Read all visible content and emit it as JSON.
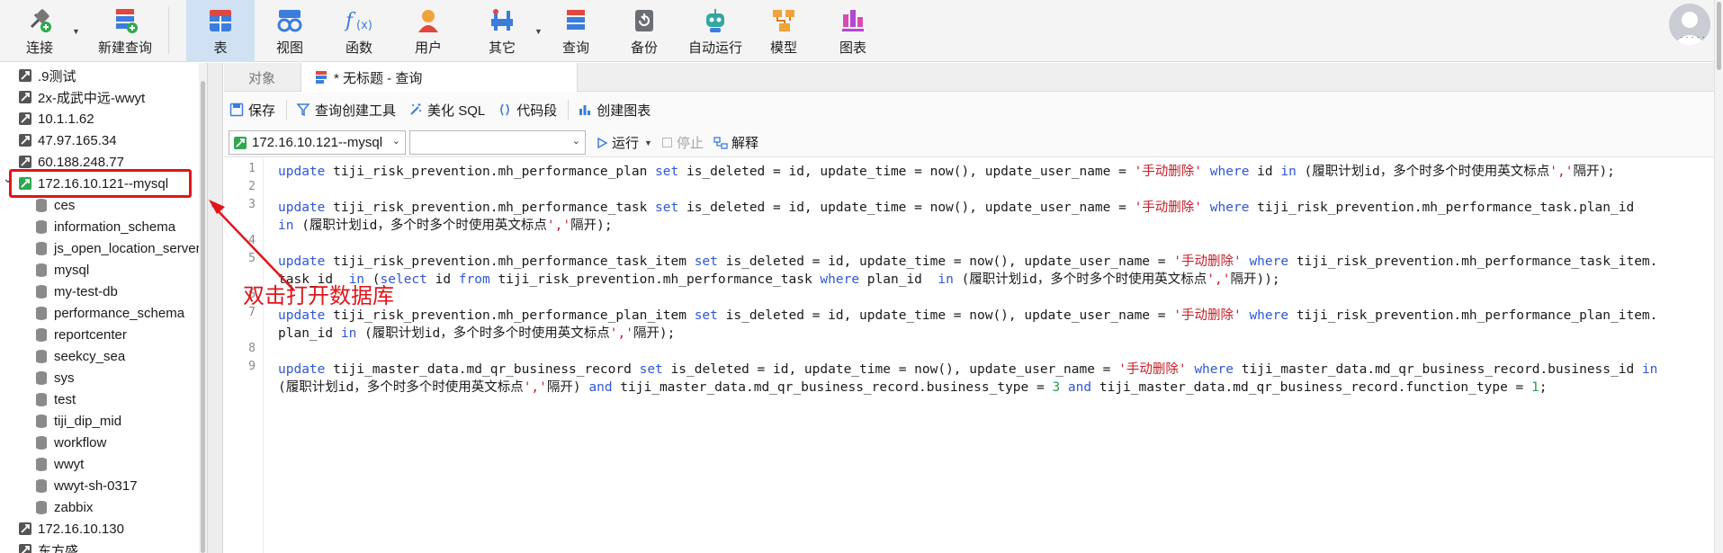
{
  "toolbar": {
    "items": [
      {
        "label": "连接",
        "icon": "plug-connect-icon"
      },
      {
        "label": "新建查询",
        "icon": "new-query-icon"
      },
      {
        "label": "表",
        "icon": "table-icon"
      },
      {
        "label": "视图",
        "icon": "view-glasses-icon"
      },
      {
        "label": "函数",
        "icon": "function-fx-icon"
      },
      {
        "label": "用户",
        "icon": "user-icon"
      },
      {
        "label": "其它",
        "icon": "tools-icon"
      },
      {
        "label": "查询",
        "icon": "query-icon"
      },
      {
        "label": "备份",
        "icon": "backup-icon"
      },
      {
        "label": "自动运行",
        "icon": "robot-icon"
      },
      {
        "label": "模型",
        "icon": "model-icon"
      },
      {
        "label": "图表",
        "icon": "chart-icon"
      }
    ],
    "active": "表",
    "avatar_caption": "· · · · ·"
  },
  "tree": {
    "items": [
      {
        "label": ".9测试",
        "type": "connection",
        "open": false
      },
      {
        "label": "2x-成武中远-wwyt",
        "type": "connection",
        "open": false
      },
      {
        "label": "10.1.1.62",
        "type": "connection",
        "open": false
      },
      {
        "label": "47.97.165.34",
        "type": "connection",
        "open": false
      },
      {
        "label": "60.188.248.77",
        "type": "connection",
        "open": false
      },
      {
        "label": "172.16.10.121--mysql",
        "type": "connection",
        "open": true
      },
      {
        "label": "ces",
        "type": "database"
      },
      {
        "label": "information_schema",
        "type": "database"
      },
      {
        "label": "js_open_location_server",
        "type": "database"
      },
      {
        "label": "mysql",
        "type": "database"
      },
      {
        "label": "my-test-db",
        "type": "database"
      },
      {
        "label": "performance_schema",
        "type": "database"
      },
      {
        "label": "reportcenter",
        "type": "database"
      },
      {
        "label": "seekcy_sea",
        "type": "database"
      },
      {
        "label": "sys",
        "type": "database"
      },
      {
        "label": "test",
        "type": "database"
      },
      {
        "label": "tiji_dip_mid",
        "type": "database"
      },
      {
        "label": "workflow",
        "type": "database"
      },
      {
        "label": "wwyt",
        "type": "database"
      },
      {
        "label": "wwyt-sh-0317",
        "type": "database"
      },
      {
        "label": "zabbix",
        "type": "database"
      },
      {
        "label": "172.16.10.130",
        "type": "connection",
        "open": false
      },
      {
        "label": "东方盛",
        "type": "connection",
        "open": false
      }
    ]
  },
  "tabs": {
    "objects": "对象",
    "query": "* 无标题 - 查询"
  },
  "actions": {
    "save": "保存",
    "query_builder": "查询创建工具",
    "beautify": "美化 SQL",
    "snippet": "代码段",
    "create_chart": "创建图表"
  },
  "runbar": {
    "connection": "172.16.10.121--mysql",
    "database": "",
    "run": "运行",
    "stop": "停止",
    "explain": "解释"
  },
  "editor": {
    "line_numbers": [
      "1",
      "2",
      "3",
      "4",
      "5",
      "6",
      "7",
      "8",
      "9"
    ]
  },
  "annotation": {
    "text": "双击打开数据库",
    "color": "#e0151b"
  },
  "colors": {
    "keyword": "#2f57d6",
    "string": "#c6202a",
    "number": "#2aa14b",
    "active_toolbar": "#cfe1f3"
  }
}
